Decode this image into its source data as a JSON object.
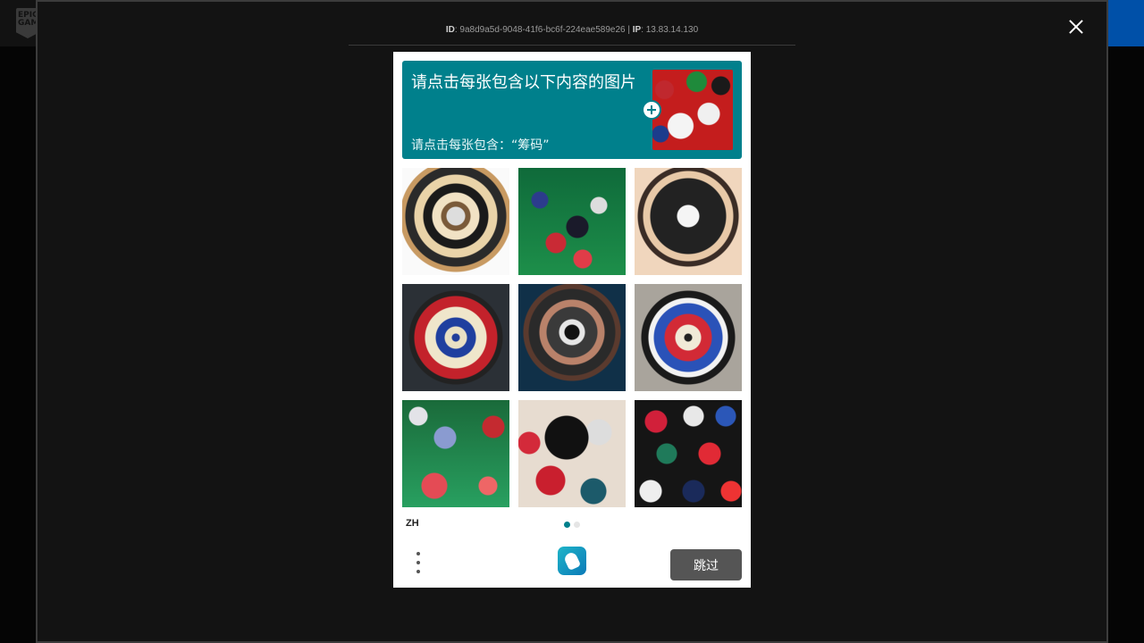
{
  "site": {
    "logo_text": "EPIC GAMES",
    "brand_color": "#0050a8"
  },
  "modal": {
    "ray_prefix_label": "ID",
    "ray_id": "9a8d9a5d-9048-41f6-bc6f-224eae589e26",
    "ip_label": "IP",
    "ip_value": "13.83.14.130",
    "close_icon": "close-icon"
  },
  "captcha": {
    "prompt_title": "请点击每张包含以下内容的图片",
    "prompt_subtitle": "请点击每张包含：“筹码”",
    "accent_color": "#00808c",
    "tiles": [
      {
        "label": "dartboard target"
      },
      {
        "label": "poker chips on table"
      },
      {
        "label": "vinyl record"
      },
      {
        "label": "dartboard"
      },
      {
        "label": "roulette wheel"
      },
      {
        "label": "dartboard"
      },
      {
        "label": "poker chips"
      },
      {
        "label": "poker chips"
      },
      {
        "label": "poker chips"
      }
    ],
    "language": "ZH",
    "page_current": 1,
    "page_total": 2,
    "submit_label": "跳过"
  }
}
